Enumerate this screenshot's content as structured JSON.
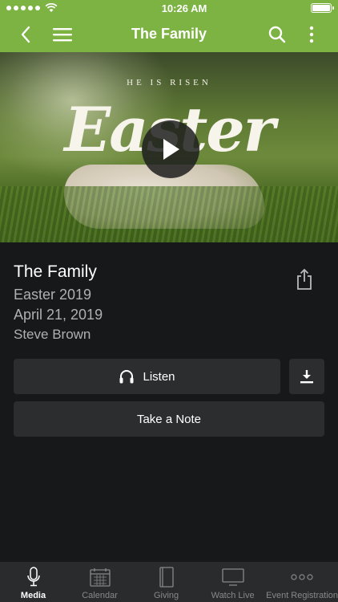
{
  "status_bar": {
    "time": "10:26 AM"
  },
  "nav": {
    "title": "The Family"
  },
  "hero": {
    "subtitle": "HE IS RISEN",
    "title": "Easter"
  },
  "sermon": {
    "title": "The Family",
    "series": "Easter 2019",
    "date": "April 21, 2019",
    "speaker": "Steve Brown"
  },
  "actions": {
    "listen_label": "Listen",
    "note_label": "Take a Note"
  },
  "tabs": [
    {
      "label": "Media",
      "icon": "microphone-icon",
      "active": true
    },
    {
      "label": "Calendar",
      "icon": "calendar-icon",
      "active": false
    },
    {
      "label": "Giving",
      "icon": "book-icon",
      "active": false
    },
    {
      "label": "Watch Live",
      "icon": "tv-icon",
      "active": false
    },
    {
      "label": "Event Registration",
      "icon": "ellipsis-icon",
      "active": false
    }
  ],
  "colors": {
    "accent": "#7cb342",
    "background": "#17181a",
    "button": "#2c2d2f"
  }
}
